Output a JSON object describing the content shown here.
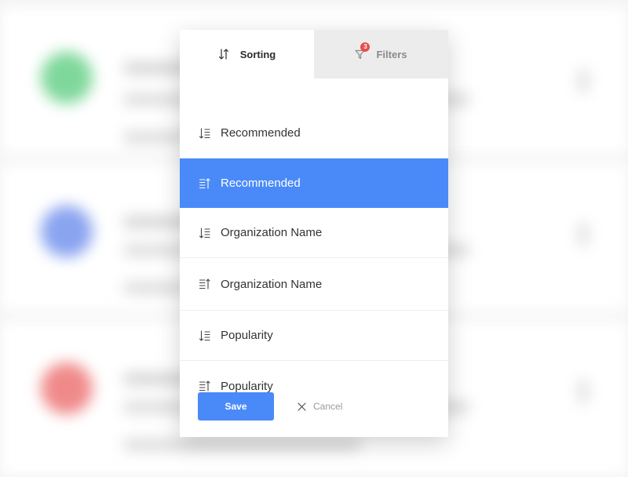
{
  "tabs": {
    "sorting": {
      "label": "Sorting",
      "icon": "sort-arrows-icon"
    },
    "filters": {
      "label": "Filters",
      "icon": "filter-icon",
      "badge_count": "3"
    }
  },
  "sort_options": [
    {
      "label": "Recommended",
      "direction": "descending",
      "icon": "sort-descending-icon",
      "selected": false
    },
    {
      "label": "Recommended",
      "direction": "ascending",
      "icon": "sort-ascending-icon",
      "selected": true
    },
    {
      "label": "Organization Name",
      "direction": "descending",
      "icon": "sort-descending-icon",
      "selected": false
    },
    {
      "label": "Organization Name",
      "direction": "ascending",
      "icon": "sort-ascending-icon",
      "selected": false
    },
    {
      "label": "Popularity",
      "direction": "descending",
      "icon": "sort-descending-icon",
      "selected": false
    },
    {
      "label": "Popularity",
      "direction": "ascending",
      "icon": "sort-ascending-icon",
      "selected": false
    }
  ],
  "actions": {
    "save_label": "Save",
    "cancel_label": "Cancel"
  },
  "colors": {
    "accent": "#4a8af8",
    "badge": "#e84c4c",
    "avatar_colors": [
      "#7fd89b",
      "#8aa4f0",
      "#f08a8a"
    ]
  }
}
